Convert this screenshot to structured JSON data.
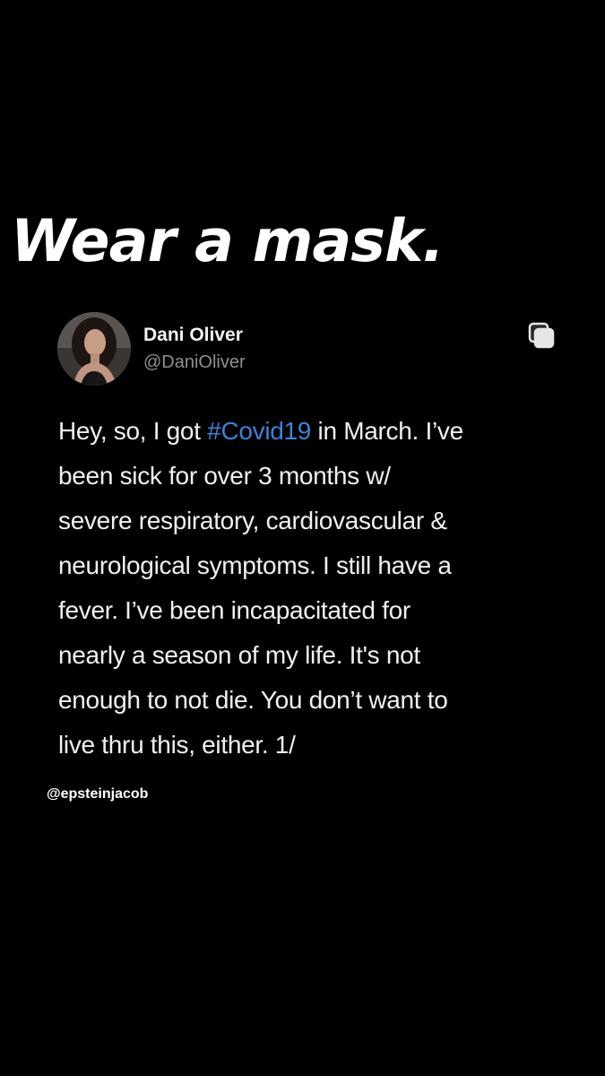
{
  "headline": "Wear a mask.",
  "tweet": {
    "author_name": "Dani Oliver",
    "author_handle": "@DaniOliver",
    "hashtag_color": "#3a83d6",
    "share_icon": "copy-icon",
    "lines": [
      {
        "before": "Hey, so, I got ",
        "hashtag": "#Covid19",
        "after": " in March. I’ve"
      },
      {
        "text": "been sick for over 3 months w/"
      },
      {
        "text": "severe respiratory, cardiovascular &"
      },
      {
        "text": "neurological symptoms. I still have a"
      },
      {
        "text": "fever. I’ve been incapacitated for"
      },
      {
        "text": "nearly a season of my life. It's not"
      },
      {
        "text": "enough to not die. You don’t want to"
      },
      {
        "text": "live thru this, either. 1/"
      }
    ]
  },
  "credit": "@epsteinjacob"
}
